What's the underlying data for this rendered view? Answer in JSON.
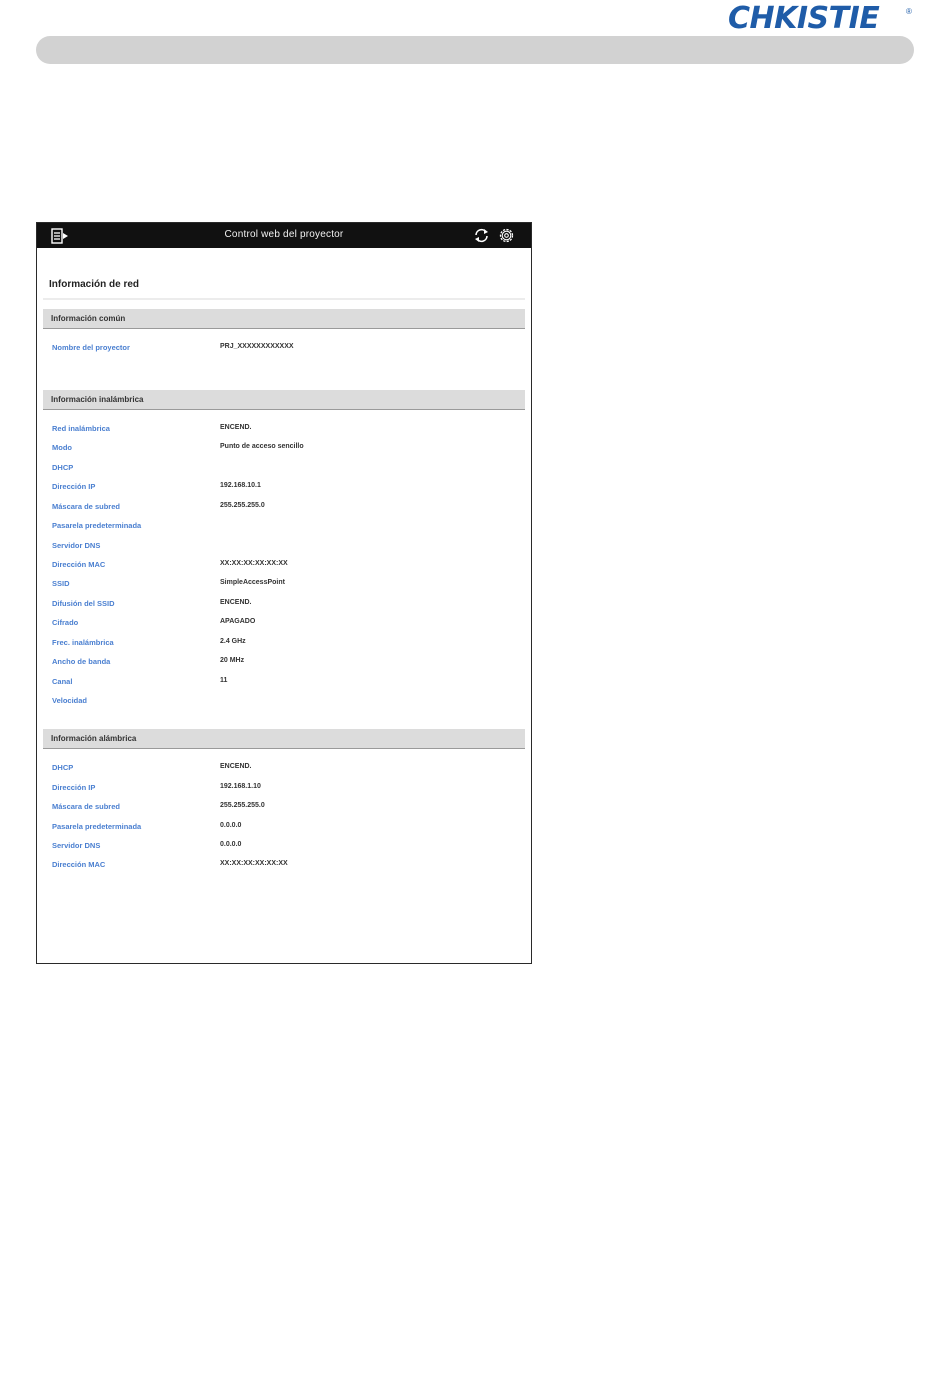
{
  "brand": {
    "logo_text": "CHKISTIE",
    "registered": "®",
    "color": "#1f5ca8"
  },
  "app": {
    "title": "Control web del proyector",
    "menu_icon": "menu-icon",
    "refresh_icon": "refresh-icon",
    "settings_icon": "gear-icon"
  },
  "page": {
    "heading": "Información de red"
  },
  "sections": {
    "common": {
      "title": "Información común",
      "rows": [
        {
          "label": "Nombre del proyector",
          "value": "PRJ_XXXXXXXXXXXX"
        }
      ]
    },
    "wireless": {
      "title": "Información inalámbrica",
      "rows": [
        {
          "label": "Red inalámbrica",
          "value": "ENCEND."
        },
        {
          "label": "Modo",
          "value": "Punto de acceso sencillo"
        },
        {
          "label": "DHCP",
          "value": ""
        },
        {
          "label": "Dirección IP",
          "value": "192.168.10.1"
        },
        {
          "label": "Máscara de subred",
          "value": "255.255.255.0"
        },
        {
          "label": "Pasarela predeterminada",
          "value": ""
        },
        {
          "label": "Servidor DNS",
          "value": ""
        },
        {
          "label": "Dirección MAC",
          "value": "XX:XX:XX:XX:XX:XX"
        },
        {
          "label": "SSID",
          "value": "SimpleAccessPoint"
        },
        {
          "label": "Difusión del SSID",
          "value": "ENCEND."
        },
        {
          "label": "Cifrado",
          "value": "APAGADO"
        },
        {
          "label": "Frec. inalámbrica",
          "value": "2.4 GHz"
        },
        {
          "label": "Ancho de banda",
          "value": "20 MHz"
        },
        {
          "label": "Canal",
          "value": "11"
        },
        {
          "label": "Velocidad",
          "value": ""
        }
      ]
    },
    "wired": {
      "title": "Información alámbrica",
      "rows": [
        {
          "label": "DHCP",
          "value": "ENCEND."
        },
        {
          "label": "Dirección IP",
          "value": "192.168.1.10"
        },
        {
          "label": "Máscara de subred",
          "value": "255.255.255.0"
        },
        {
          "label": "Pasarela predeterminada",
          "value": "0.0.0.0"
        },
        {
          "label": "Servidor DNS",
          "value": "0.0.0.0"
        },
        {
          "label": "Dirección MAC",
          "value": "XX:XX:XX:XX:XX:XX"
        }
      ]
    }
  }
}
